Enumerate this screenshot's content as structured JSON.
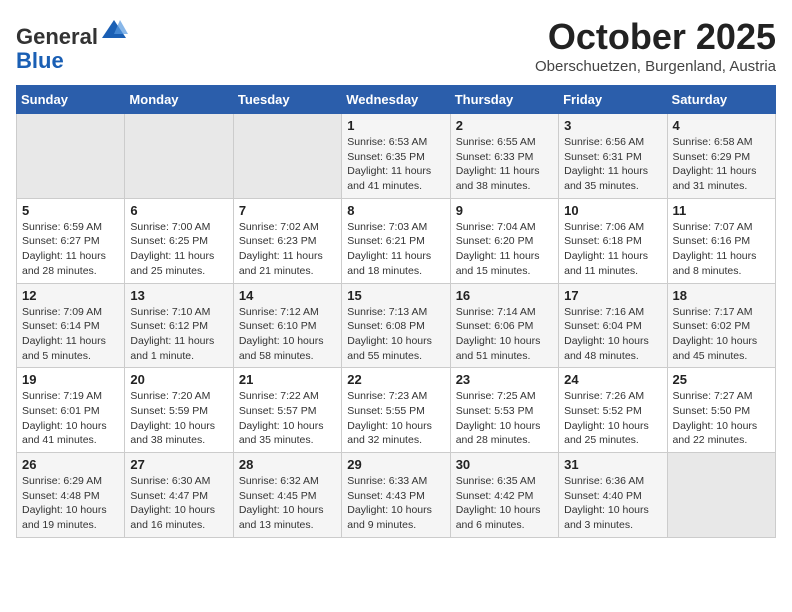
{
  "header": {
    "logo_line1": "General",
    "logo_line2": "Blue",
    "month": "October 2025",
    "subtitle": "Oberschuetzen, Burgenland, Austria"
  },
  "days_of_week": [
    "Sunday",
    "Monday",
    "Tuesday",
    "Wednesday",
    "Thursday",
    "Friday",
    "Saturday"
  ],
  "weeks": [
    [
      {
        "day": "",
        "sunrise": "",
        "sunset": "",
        "daylight": ""
      },
      {
        "day": "",
        "sunrise": "",
        "sunset": "",
        "daylight": ""
      },
      {
        "day": "",
        "sunrise": "",
        "sunset": "",
        "daylight": ""
      },
      {
        "day": "1",
        "sunrise": "Sunrise: 6:53 AM",
        "sunset": "Sunset: 6:35 PM",
        "daylight": "Daylight: 11 hours and 41 minutes."
      },
      {
        "day": "2",
        "sunrise": "Sunrise: 6:55 AM",
        "sunset": "Sunset: 6:33 PM",
        "daylight": "Daylight: 11 hours and 38 minutes."
      },
      {
        "day": "3",
        "sunrise": "Sunrise: 6:56 AM",
        "sunset": "Sunset: 6:31 PM",
        "daylight": "Daylight: 11 hours and 35 minutes."
      },
      {
        "day": "4",
        "sunrise": "Sunrise: 6:58 AM",
        "sunset": "Sunset: 6:29 PM",
        "daylight": "Daylight: 11 hours and 31 minutes."
      }
    ],
    [
      {
        "day": "5",
        "sunrise": "Sunrise: 6:59 AM",
        "sunset": "Sunset: 6:27 PM",
        "daylight": "Daylight: 11 hours and 28 minutes."
      },
      {
        "day": "6",
        "sunrise": "Sunrise: 7:00 AM",
        "sunset": "Sunset: 6:25 PM",
        "daylight": "Daylight: 11 hours and 25 minutes."
      },
      {
        "day": "7",
        "sunrise": "Sunrise: 7:02 AM",
        "sunset": "Sunset: 6:23 PM",
        "daylight": "Daylight: 11 hours and 21 minutes."
      },
      {
        "day": "8",
        "sunrise": "Sunrise: 7:03 AM",
        "sunset": "Sunset: 6:21 PM",
        "daylight": "Daylight: 11 hours and 18 minutes."
      },
      {
        "day": "9",
        "sunrise": "Sunrise: 7:04 AM",
        "sunset": "Sunset: 6:20 PM",
        "daylight": "Daylight: 11 hours and 15 minutes."
      },
      {
        "day": "10",
        "sunrise": "Sunrise: 7:06 AM",
        "sunset": "Sunset: 6:18 PM",
        "daylight": "Daylight: 11 hours and 11 minutes."
      },
      {
        "day": "11",
        "sunrise": "Sunrise: 7:07 AM",
        "sunset": "Sunset: 6:16 PM",
        "daylight": "Daylight: 11 hours and 8 minutes."
      }
    ],
    [
      {
        "day": "12",
        "sunrise": "Sunrise: 7:09 AM",
        "sunset": "Sunset: 6:14 PM",
        "daylight": "Daylight: 11 hours and 5 minutes."
      },
      {
        "day": "13",
        "sunrise": "Sunrise: 7:10 AM",
        "sunset": "Sunset: 6:12 PM",
        "daylight": "Daylight: 11 hours and 1 minute."
      },
      {
        "day": "14",
        "sunrise": "Sunrise: 7:12 AM",
        "sunset": "Sunset: 6:10 PM",
        "daylight": "Daylight: 10 hours and 58 minutes."
      },
      {
        "day": "15",
        "sunrise": "Sunrise: 7:13 AM",
        "sunset": "Sunset: 6:08 PM",
        "daylight": "Daylight: 10 hours and 55 minutes."
      },
      {
        "day": "16",
        "sunrise": "Sunrise: 7:14 AM",
        "sunset": "Sunset: 6:06 PM",
        "daylight": "Daylight: 10 hours and 51 minutes."
      },
      {
        "day": "17",
        "sunrise": "Sunrise: 7:16 AM",
        "sunset": "Sunset: 6:04 PM",
        "daylight": "Daylight: 10 hours and 48 minutes."
      },
      {
        "day": "18",
        "sunrise": "Sunrise: 7:17 AM",
        "sunset": "Sunset: 6:02 PM",
        "daylight": "Daylight: 10 hours and 45 minutes."
      }
    ],
    [
      {
        "day": "19",
        "sunrise": "Sunrise: 7:19 AM",
        "sunset": "Sunset: 6:01 PM",
        "daylight": "Daylight: 10 hours and 41 minutes."
      },
      {
        "day": "20",
        "sunrise": "Sunrise: 7:20 AM",
        "sunset": "Sunset: 5:59 PM",
        "daylight": "Daylight: 10 hours and 38 minutes."
      },
      {
        "day": "21",
        "sunrise": "Sunrise: 7:22 AM",
        "sunset": "Sunset: 5:57 PM",
        "daylight": "Daylight: 10 hours and 35 minutes."
      },
      {
        "day": "22",
        "sunrise": "Sunrise: 7:23 AM",
        "sunset": "Sunset: 5:55 PM",
        "daylight": "Daylight: 10 hours and 32 minutes."
      },
      {
        "day": "23",
        "sunrise": "Sunrise: 7:25 AM",
        "sunset": "Sunset: 5:53 PM",
        "daylight": "Daylight: 10 hours and 28 minutes."
      },
      {
        "day": "24",
        "sunrise": "Sunrise: 7:26 AM",
        "sunset": "Sunset: 5:52 PM",
        "daylight": "Daylight: 10 hours and 25 minutes."
      },
      {
        "day": "25",
        "sunrise": "Sunrise: 7:27 AM",
        "sunset": "Sunset: 5:50 PM",
        "daylight": "Daylight: 10 hours and 22 minutes."
      }
    ],
    [
      {
        "day": "26",
        "sunrise": "Sunrise: 6:29 AM",
        "sunset": "Sunset: 4:48 PM",
        "daylight": "Daylight: 10 hours and 19 minutes."
      },
      {
        "day": "27",
        "sunrise": "Sunrise: 6:30 AM",
        "sunset": "Sunset: 4:47 PM",
        "daylight": "Daylight: 10 hours and 16 minutes."
      },
      {
        "day": "28",
        "sunrise": "Sunrise: 6:32 AM",
        "sunset": "Sunset: 4:45 PM",
        "daylight": "Daylight: 10 hours and 13 minutes."
      },
      {
        "day": "29",
        "sunrise": "Sunrise: 6:33 AM",
        "sunset": "Sunset: 4:43 PM",
        "daylight": "Daylight: 10 hours and 9 minutes."
      },
      {
        "day": "30",
        "sunrise": "Sunrise: 6:35 AM",
        "sunset": "Sunset: 4:42 PM",
        "daylight": "Daylight: 10 hours and 6 minutes."
      },
      {
        "day": "31",
        "sunrise": "Sunrise: 6:36 AM",
        "sunset": "Sunset: 4:40 PM",
        "daylight": "Daylight: 10 hours and 3 minutes."
      },
      {
        "day": "",
        "sunrise": "",
        "sunset": "",
        "daylight": ""
      }
    ]
  ]
}
